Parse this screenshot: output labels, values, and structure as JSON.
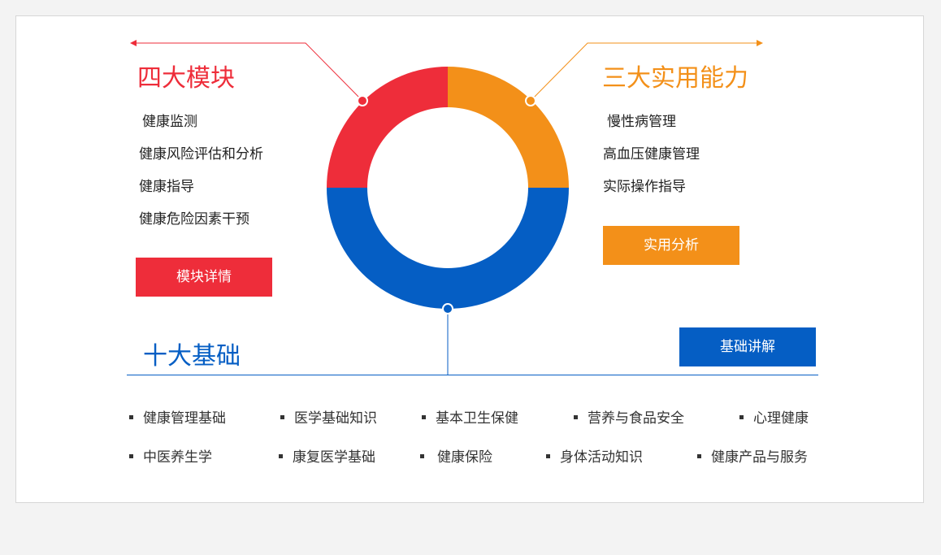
{
  "modules": {
    "title": "四大模块",
    "items": [
      "健康监测",
      "健康风险评估和分析",
      "健康指导",
      "健康危险因素干预"
    ],
    "button": "模块详情",
    "color": "#ee2d3a"
  },
  "abilities": {
    "title": "三大实用能力",
    "items": [
      "慢性病管理",
      "高血压健康管理",
      "实际操作指导"
    ],
    "button": "实用分析",
    "color": "#f39019"
  },
  "basics": {
    "title": "十大基础",
    "button": "基础讲解",
    "color": "#055ec4",
    "rows": [
      [
        "健康管理基础",
        "医学基础知识",
        "基本卫生保健",
        "营养与食品安全",
        "心理健康"
      ],
      [
        "中医养生学",
        "康复医学基础",
        "健康保险",
        "身体活动知识",
        "健康产品与服务"
      ]
    ]
  },
  "ring": {
    "segments": [
      {
        "key": "modules",
        "value": 0.25,
        "color": "#ee2d3a"
      },
      {
        "key": "abilities",
        "value": 0.25,
        "color": "#f39019"
      },
      {
        "key": "basics",
        "value": 0.5,
        "color": "#055ec4"
      }
    ]
  }
}
